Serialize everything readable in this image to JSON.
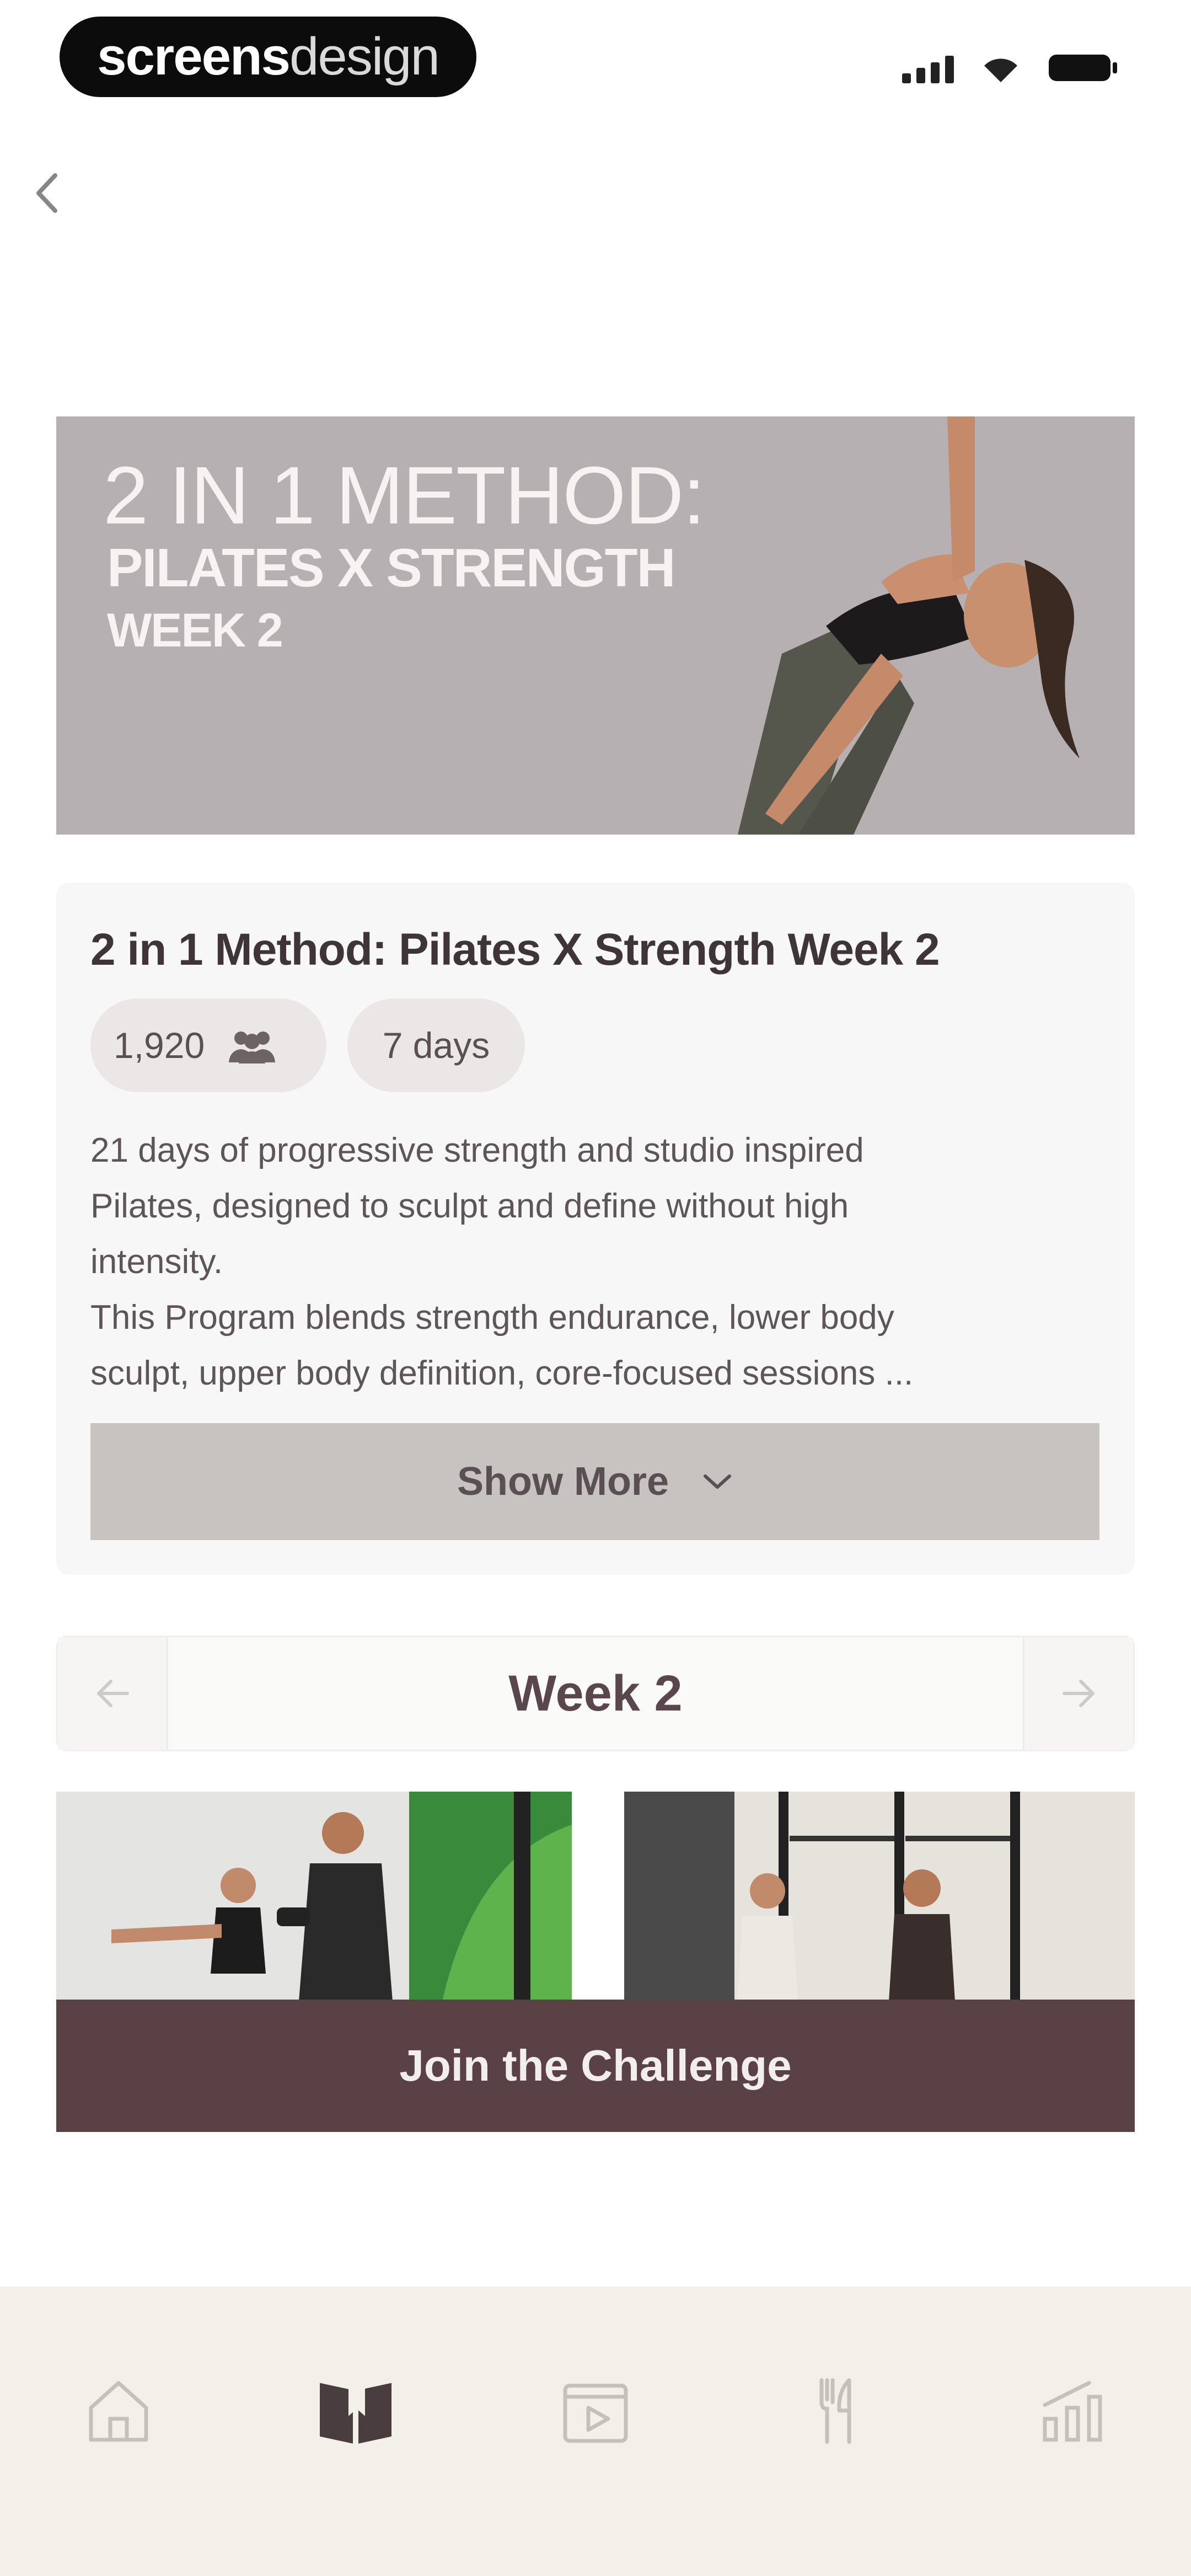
{
  "status_bar": {
    "brand_bold": "screens",
    "brand_light": "design"
  },
  "hero": {
    "title_line1": "2 IN 1 METHOD:",
    "title_line2": "PILATES X STRENGTH",
    "title_line3": "WEEK 2"
  },
  "program": {
    "title": "2 in 1 Method: Pilates X Strength Week 2",
    "participants": "1,920",
    "duration": "7 days",
    "description_lines": [
      "21 days of progressive strength and studio inspired",
      "Pilates, designed to sculpt and define without high",
      "intensity.",
      "This Program blends strength endurance, lower body",
      "sculpt, upper body definition, core-focused sessions ..."
    ],
    "show_more_label": "Show More"
  },
  "week_nav": {
    "label": "Week 2"
  },
  "cta": {
    "join_label": "Join the Challenge"
  },
  "colors": {
    "accent": "#5a4145",
    "hero_bg": "#b7b0b2",
    "tab_bar_bg": "#f3f0ea"
  },
  "icons": {
    "back": "chevron-left-icon",
    "participants": "group-icon",
    "show_more": "chevron-down-icon",
    "tabs": [
      "home-icon",
      "book-icon",
      "video-icon",
      "utensils-icon",
      "chart-icon"
    ]
  }
}
